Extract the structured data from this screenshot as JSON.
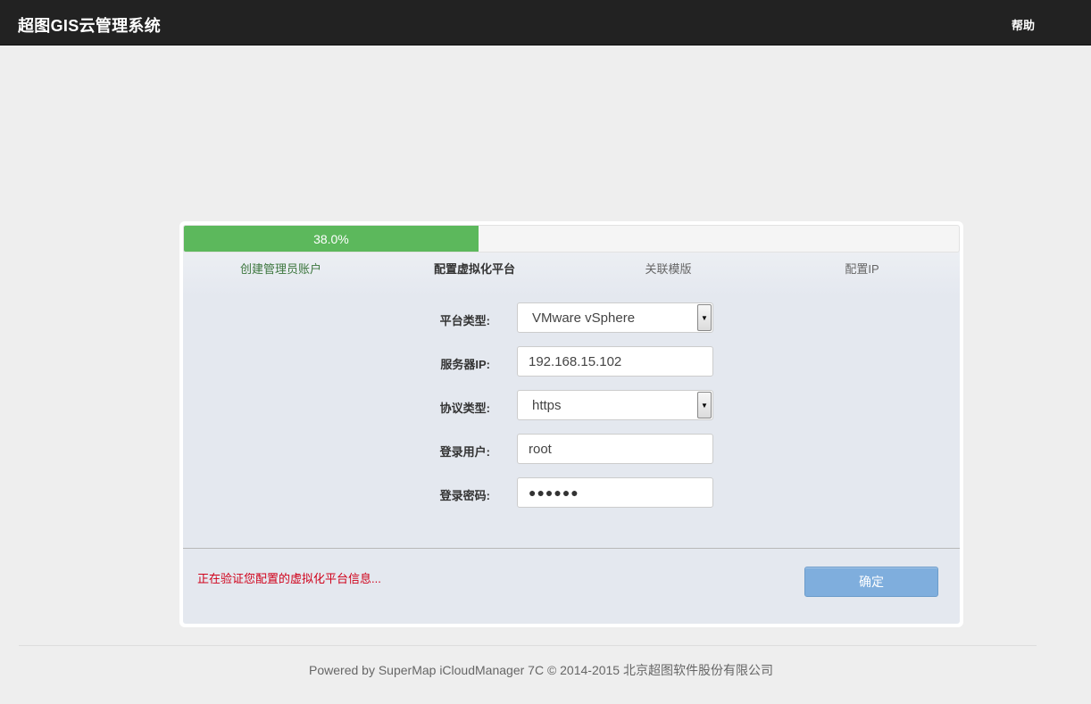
{
  "header": {
    "title": "超图GIS云管理系统",
    "help_label": "帮助"
  },
  "progress": {
    "label": "38.0%",
    "value": 38.0
  },
  "steps": [
    {
      "label": "创建管理员账户",
      "state": "done"
    },
    {
      "label": "配置虚拟化平台",
      "state": "active"
    },
    {
      "label": "关联模版",
      "state": "pending"
    },
    {
      "label": "配置IP",
      "state": "pending"
    }
  ],
  "form": {
    "platform_type": {
      "label": "平台类型:",
      "value": "VMware vSphere"
    },
    "server_ip": {
      "label": "服务器IP:",
      "value": "192.168.15.102"
    },
    "protocol_type": {
      "label": "协议类型:",
      "value": "https"
    },
    "login_user": {
      "label": "登录用户:",
      "value": "root"
    },
    "login_password": {
      "label": "登录密码:",
      "value": "●●●●●●"
    }
  },
  "status_message": "正在验证您配置的虚拟化平台信息...",
  "confirm_label": "确定",
  "footer": {
    "text": "Powered by SuperMap iCloudManager 7C © 2014-2015 北京超图软件股份有限公司"
  },
  "colors": {
    "topbar": "#222222",
    "progress": "#5cb85c",
    "confirm_button": "#7faedd",
    "status_text": "#d0021b"
  },
  "icons": {
    "select_arrow": "caret-down-icon"
  }
}
